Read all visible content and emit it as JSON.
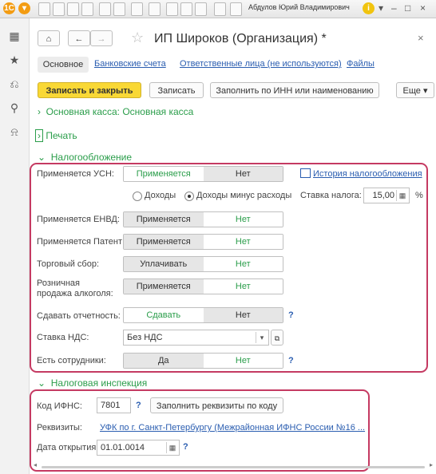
{
  "titlebar": {
    "logo": "1С",
    "menu_icon": "▾",
    "user": "Абдулов Юрий Владимирович",
    "info_icon": "i"
  },
  "nav": {
    "home": "⌂",
    "back": "←",
    "forward": "→",
    "star": "☆",
    "close": "×"
  },
  "page_title": "ИП Широков (Организация) *",
  "tabs": {
    "active": "Основное",
    "bank": "Банковские счета",
    "responsible": "Ответственные лица (не используются)",
    "files": "Файлы"
  },
  "toolbar": {
    "save_close": "Записать и закрыть",
    "save": "Записать",
    "fill_inn": "Заполнить по ИНН или наименованию",
    "more": "Еще"
  },
  "sections": {
    "cash": "Основная касса: Основная касса",
    "print": "Печать",
    "tax": "Налогообложение",
    "inspection": "Налоговая инспекция"
  },
  "tax": {
    "usn_label": "Применяется УСН:",
    "usn_yes": "Применяется",
    "usn_no": "Нет",
    "history_link": "История налогообложения",
    "income": "Доходы",
    "income_minus": "Доходы минус расходы",
    "rate_label": "Ставка налога:",
    "rate_value": "15,00",
    "percent": "%",
    "envd_label": "Применяется ЕНВД:",
    "envd_yes": "Применяется",
    "envd_no": "Нет",
    "patent_label": "Применяется Патент:",
    "patent_yes": "Применяется",
    "patent_no": "Нет",
    "trade_label": "Торговый сбор:",
    "trade_yes": "Уплачивать",
    "trade_no": "Нет",
    "alcohol_label1": "Розничная",
    "alcohol_label2": "продажа алкоголя:",
    "alcohol_yes": "Применяется",
    "alcohol_no": "Нет",
    "report_label": "Сдавать отчетность:",
    "report_yes": "Сдавать",
    "report_no": "Нет",
    "vat_label": "Ставка НДС:",
    "vat_value": "Без НДС",
    "staff_label": "Есть сотрудники:",
    "staff_yes": "Да",
    "staff_no": "Нет",
    "help": "?"
  },
  "inspection": {
    "code_label": "Код ИФНС:",
    "code_value": "7801",
    "fill_button": "Заполнить реквизиты по коду",
    "req_label": "Реквизиты:",
    "req_value": "УФК по г. Санкт-Петербургу (Межрайонная ИФНС России №16 ...",
    "date_label": "Дата открытия:",
    "date_value": "01.01.0014",
    "help": "?"
  },
  "colors": {
    "accent": "#2a9d4a",
    "link": "#2a5db0",
    "highlight": "#c53a62",
    "primary_button": "#f9d835"
  }
}
